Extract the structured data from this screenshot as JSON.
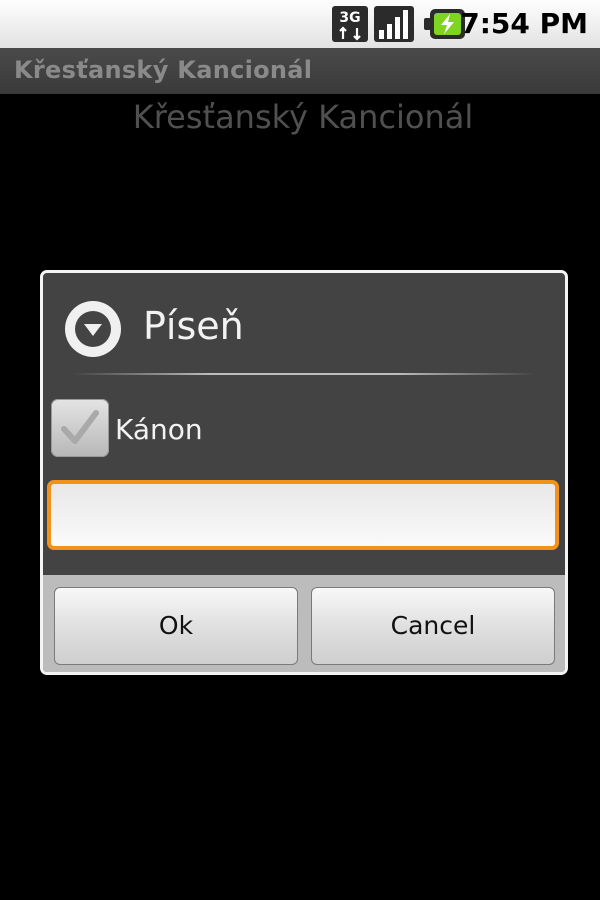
{
  "status_bar": {
    "network_label": "3G",
    "time": "7:54 PM",
    "icons": [
      "3g-network-icon",
      "signal-strength-icon",
      "battery-charging-icon"
    ]
  },
  "app": {
    "title": "Křesťanský Kancionál",
    "heading": "Křesťanský Kancionál"
  },
  "dialog": {
    "title": "Píseň",
    "icon": "dropdown-circle-icon",
    "checkbox": {
      "label": "Kánon",
      "checked": true
    },
    "input": {
      "value": "",
      "placeholder": ""
    },
    "buttons": {
      "ok": "Ok",
      "cancel": "Cancel"
    }
  },
  "colors": {
    "background": "#000000",
    "dialog_background": "#434343",
    "focus_border": "#f3921a",
    "button_bar": "#bcbcbc"
  }
}
